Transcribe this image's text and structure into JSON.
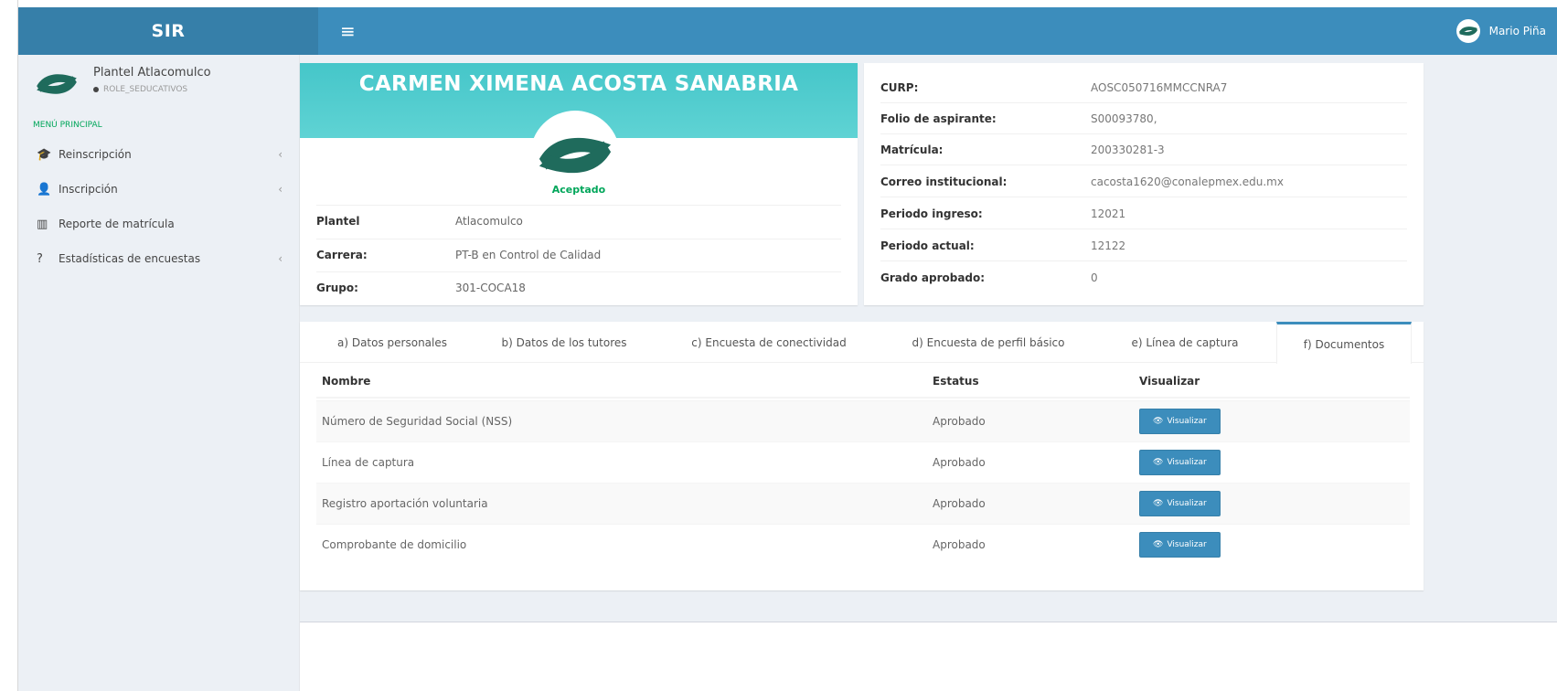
{
  "app": {
    "brand": "SIR",
    "menu_icon": "hamburger-icon"
  },
  "user": {
    "name": "Mario Piña",
    "logo_icon": "conalep-logo-icon"
  },
  "sidebar": {
    "panel": {
      "name": "Plantel Atlacomulco",
      "role": "ROLE_SEDUCATIVOS"
    },
    "header": "MENÚ PRINCIPAL",
    "items": [
      {
        "label": "Reinscripción",
        "icon": "graduation-cap-icon",
        "has_submenu": true
      },
      {
        "label": "Inscripción",
        "icon": "user-plus-icon",
        "has_submenu": true
      },
      {
        "label": "Reporte de matrícula",
        "icon": "bar-chart-icon",
        "has_submenu": false
      },
      {
        "label": "Estadísticas de encuestas",
        "icon": "question-icon",
        "has_submenu": true
      }
    ]
  },
  "profile": {
    "name": "CARMEN XIMENA ACOSTA SANABRIA",
    "status": "Aceptado",
    "fields": [
      {
        "label": "Plantel",
        "value": "Atlacomulco"
      },
      {
        "label": "Carrera:",
        "value": "PT-B en Control de Calidad"
      },
      {
        "label": "Grupo:",
        "value": "301-COCA18"
      }
    ]
  },
  "details": [
    {
      "label": "CURP:",
      "value": "AOSC050716MMCCNRA7"
    },
    {
      "label": "Folio de aspirante:",
      "value": "S00093780,"
    },
    {
      "label": "Matrícula:",
      "value": "200330281-3"
    },
    {
      "label": "Correo institucional:",
      "value": "cacosta1620@conalepmex.edu.mx"
    },
    {
      "label": "Periodo ingreso:",
      "value": "12021"
    },
    {
      "label": "Periodo actual:",
      "value": "12122"
    },
    {
      "label": "Grado aprobado:",
      "value": "0"
    }
  ],
  "tabs": [
    {
      "label": "a) Datos personales",
      "active": false
    },
    {
      "label": "b) Datos de los tutores",
      "active": false
    },
    {
      "label": "c) Encuesta de conectividad",
      "active": false
    },
    {
      "label": "d) Encuesta de perfil básico",
      "active": false
    },
    {
      "label": "e) Línea de captura",
      "active": false
    },
    {
      "label": "f) Documentos",
      "active": true
    }
  ],
  "documents": {
    "headers": [
      "Nombre",
      "Estatus",
      "Visualizar"
    ],
    "rows": [
      {
        "name": "Número de Seguridad Social (NSS)",
        "status": "Aprobado",
        "action": "Visualizar"
      },
      {
        "name": "Línea de captura",
        "status": "Aprobado",
        "action": "Visualizar"
      },
      {
        "name": "Registro aportación voluntaria",
        "status": "Aprobado",
        "action": "Visualizar"
      },
      {
        "name": "Comprobante de domicilio",
        "status": "Aprobado",
        "action": "Visualizar"
      }
    ]
  },
  "colors": {
    "primary": "#3c8dbc",
    "primary_dark": "#367fa9",
    "banner": "#4ecacc",
    "success": "#00a65a",
    "logo": "#1f6b5c"
  }
}
